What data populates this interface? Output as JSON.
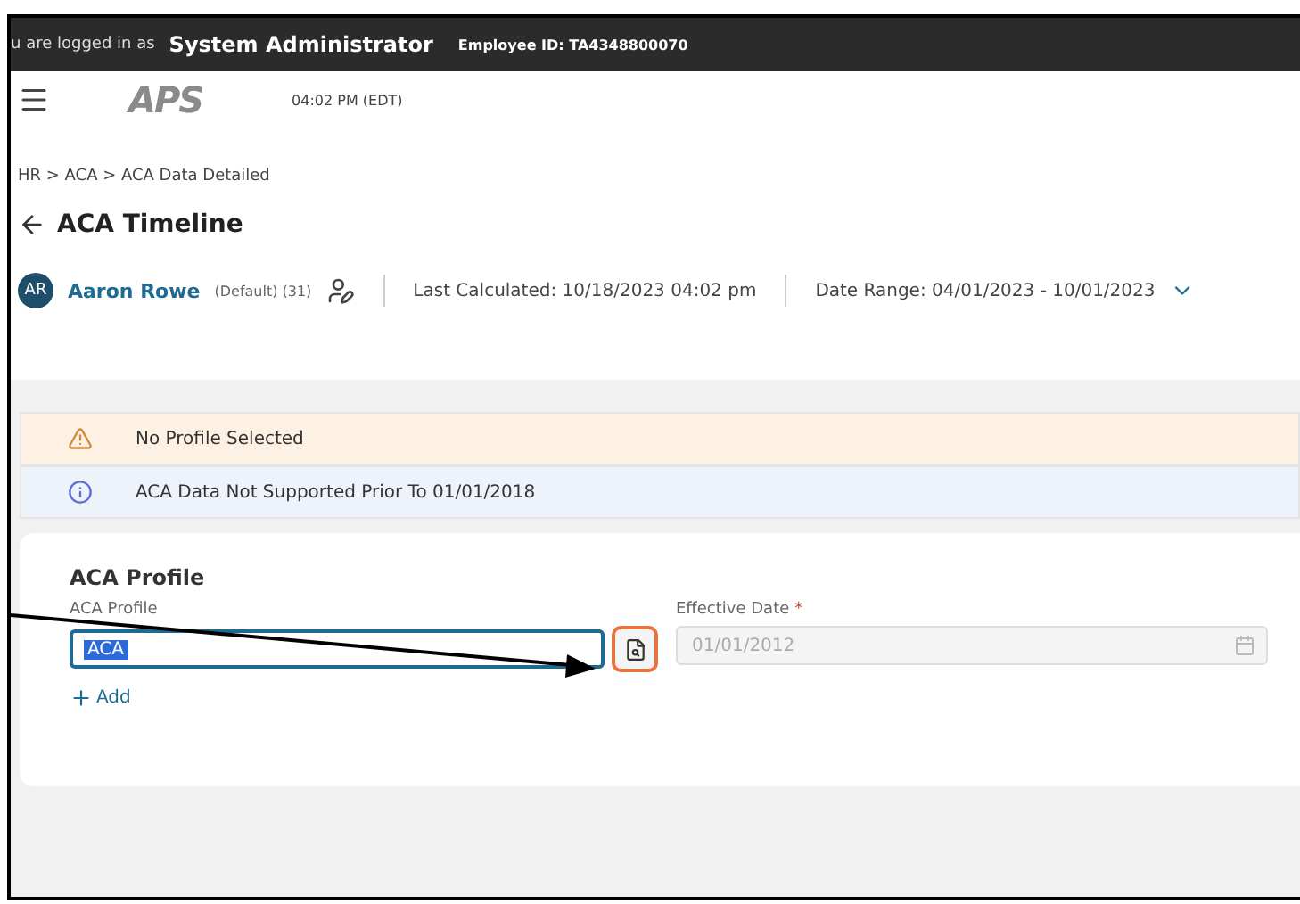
{
  "topbar": {
    "logged_in_prefix": "u are logged in as",
    "user": "System Administrator",
    "employee_id": "Employee ID: TA4348800070"
  },
  "header": {
    "logo": "APS",
    "time": "04:02 PM (EDT)"
  },
  "breadcrumb": "HR > ACA > ACA Data Detailed",
  "page_title": "ACA Timeline",
  "employee": {
    "initials": "AR",
    "name": "Aaron Rowe",
    "detail": "(Default) (31)",
    "last_calculated": "Last Calculated: 10/18/2023 04:02 pm",
    "date_range": "Date Range: 04/01/2023 - 10/01/2023"
  },
  "alerts": [
    {
      "kind": "warning",
      "text": "No Profile Selected"
    },
    {
      "kind": "info",
      "text": "ACA Data Not Supported Prior To 01/01/2018"
    }
  ],
  "card": {
    "title": "ACA Profile",
    "fields": [
      {
        "kind": "lookup",
        "label": "ACA Profile",
        "value": "ACA",
        "value_selected": true,
        "disabled": false
      },
      {
        "kind": "date",
        "label": "Effective Date",
        "required_mark": "*",
        "value": "01/01/2012",
        "disabled": true
      }
    ],
    "add_label": "Add"
  }
}
